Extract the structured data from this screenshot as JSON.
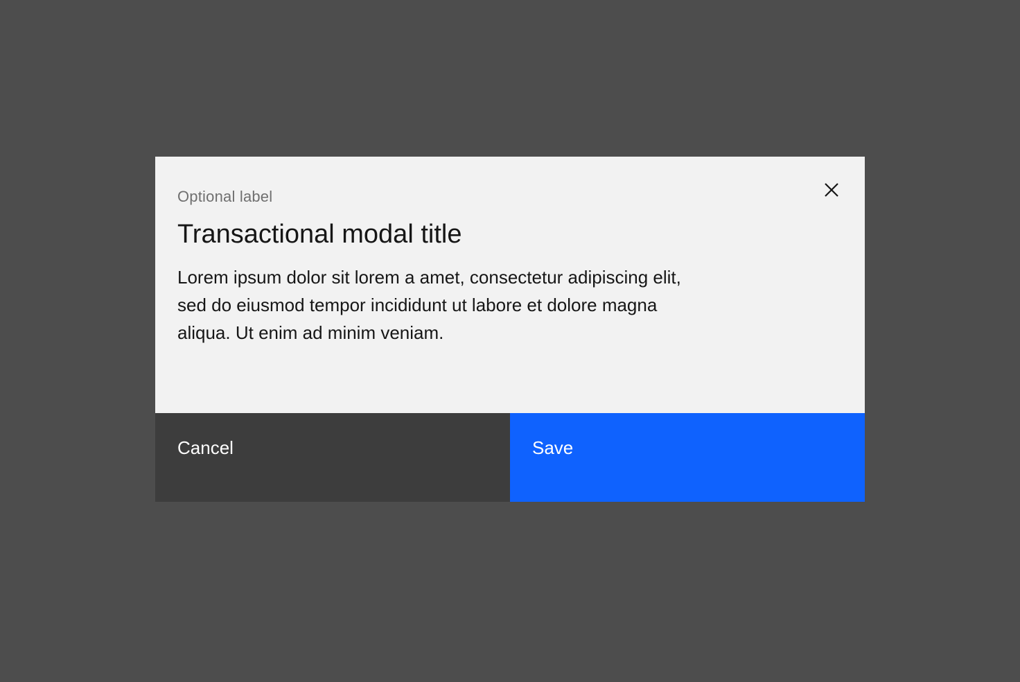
{
  "modal": {
    "label": "Optional label",
    "title": "Transactional modal title",
    "body": "Lorem ipsum dolor sit lorem a amet, consectetur adipiscing elit, sed do eiusmod tempor incididunt ut labore et dolore magna aliqua. Ut enim ad minim veniam.",
    "close_icon": "close-icon"
  },
  "footer": {
    "cancel_label": "Cancel",
    "save_label": "Save"
  },
  "colors": {
    "overlay": "#4d4d4d",
    "modal_background": "#f2f2f2",
    "secondary_button": "#3d3d3d",
    "primary_button": "#0f62fe"
  }
}
